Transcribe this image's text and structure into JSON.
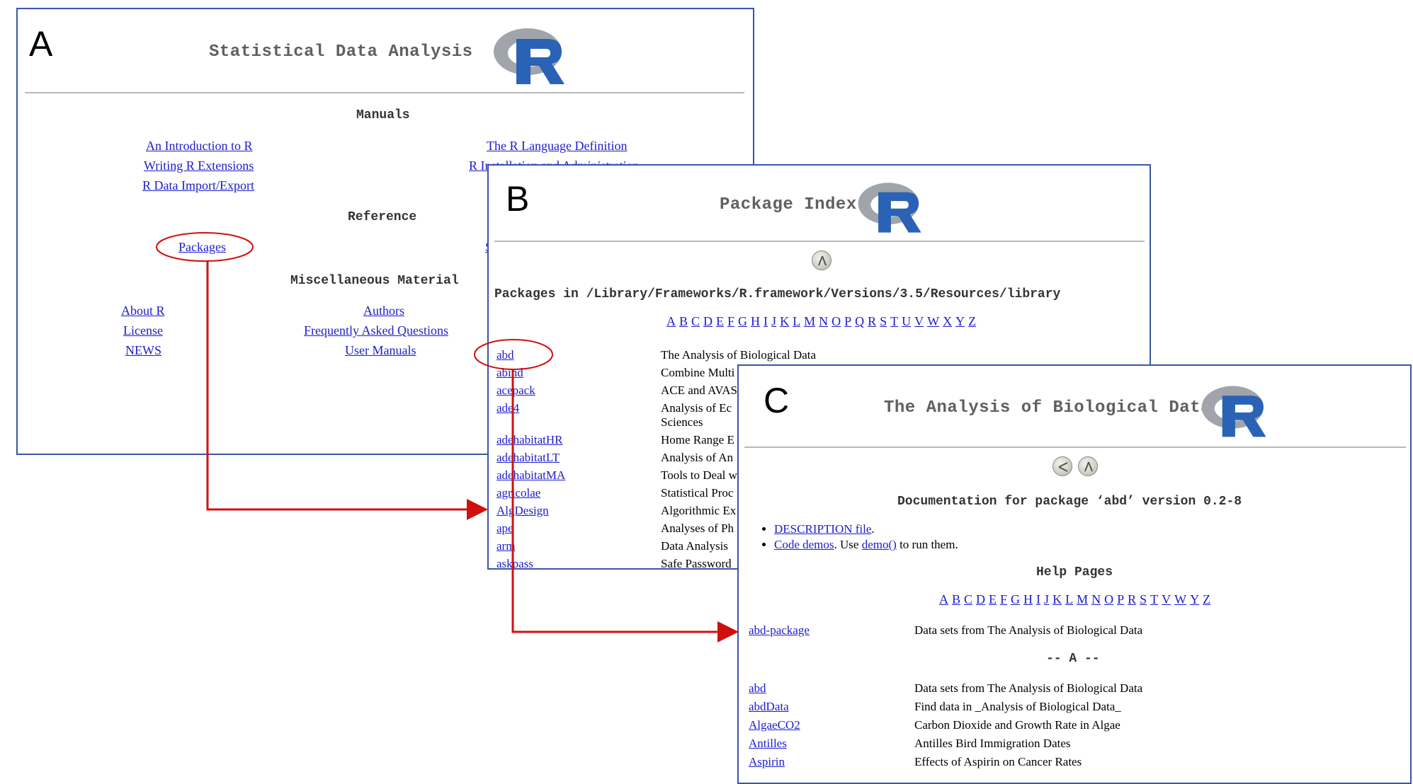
{
  "labels": {
    "a": "A",
    "b": "B",
    "c": "C"
  },
  "panel_a": {
    "title": "Statistical Data Analysis",
    "manuals_heading": "Manuals",
    "manual_links": [
      "An Introduction to R",
      "Writing R Extensions",
      "R Data Import/Export",
      "The R Language Definition",
      "R Installation and Administration"
    ],
    "reference_heading": "Reference",
    "packages_link": "Packages",
    "search_link": "S",
    "misc_heading": "Miscellaneous Material",
    "misc_left": [
      "About R",
      "License",
      "NEWS"
    ],
    "misc_mid": [
      "Authors",
      "Frequently Asked Questions",
      "User Manuals"
    ]
  },
  "panel_b": {
    "title": "Package Index",
    "packages_path": "Packages in /Library/Frameworks/R.framework/Versions/3.5/Resources/library",
    "alphabet": [
      "A",
      "B",
      "C",
      "D",
      "E",
      "F",
      "G",
      "H",
      "I",
      "J",
      "K",
      "L",
      "M",
      "N",
      "O",
      "P",
      "Q",
      "R",
      "S",
      "T",
      "U",
      "V",
      "W",
      "X",
      "Y",
      "Z"
    ],
    "packages": [
      {
        "name": "abd",
        "desc": "The Analysis of Biological Data"
      },
      {
        "name": "abind",
        "desc": "Combine Multi"
      },
      {
        "name": "acepack",
        "desc": "ACE and AVAS"
      },
      {
        "name": "ade4",
        "desc": "Analysis of Ec"
      },
      {
        "name": "",
        "desc": "Sciences"
      },
      {
        "name": "adehabitatHR",
        "desc": "Home Range E"
      },
      {
        "name": "adehabitatLT",
        "desc": "Analysis of An"
      },
      {
        "name": "adehabitatMA",
        "desc": "Tools to Deal w"
      },
      {
        "name": "agricolae",
        "desc": "Statistical Proc"
      },
      {
        "name": "AlgDesign",
        "desc": "Algorithmic Ex"
      },
      {
        "name": "ape",
        "desc": "Analyses of Ph"
      },
      {
        "name": "arm",
        "desc": "Data Analysis"
      },
      {
        "name": "askpass",
        "desc": "Safe Password"
      }
    ]
  },
  "panel_c": {
    "title": "The Analysis of Biological Data",
    "doc_heading": "Documentation for package ‘abd’ version 0.2-8",
    "bullet1_link": "DESCRIPTION file",
    "bullet1_rest": ".",
    "bullet2_link": "Code demos",
    "bullet2_mid": ". Use ",
    "bullet2_link2": "demo()",
    "bullet2_rest": " to run them.",
    "help_heading": "Help Pages",
    "alphabet": [
      "A",
      "B",
      "C",
      "D",
      "E",
      "F",
      "G",
      "H",
      "I",
      "J",
      "K",
      "L",
      "M",
      "N",
      "O",
      "P",
      "R",
      "S",
      "T",
      "V",
      "W",
      "Y",
      "Z"
    ],
    "top_entry": {
      "name": "abd-package",
      "desc": "Data sets from The Analysis of Biological Data"
    },
    "section_marker": "-- A --",
    "entries": [
      {
        "name": "abd",
        "desc": "Data sets from The Analysis of Biological Data"
      },
      {
        "name": "abdData",
        "desc": "Find data in _Analysis of Biological Data_"
      },
      {
        "name": "AlgaeCO2",
        "desc": "Carbon Dioxide and Growth Rate in Algae"
      },
      {
        "name": "Antilles",
        "desc": "Antilles Bird Immigration Dates"
      },
      {
        "name": "Aspirin",
        "desc": "Effects of Aspirin on Cancer Rates"
      }
    ]
  },
  "colors": {
    "link": "#1c1ccc",
    "arrow": "#d01010",
    "frame": "#3a56a8"
  }
}
